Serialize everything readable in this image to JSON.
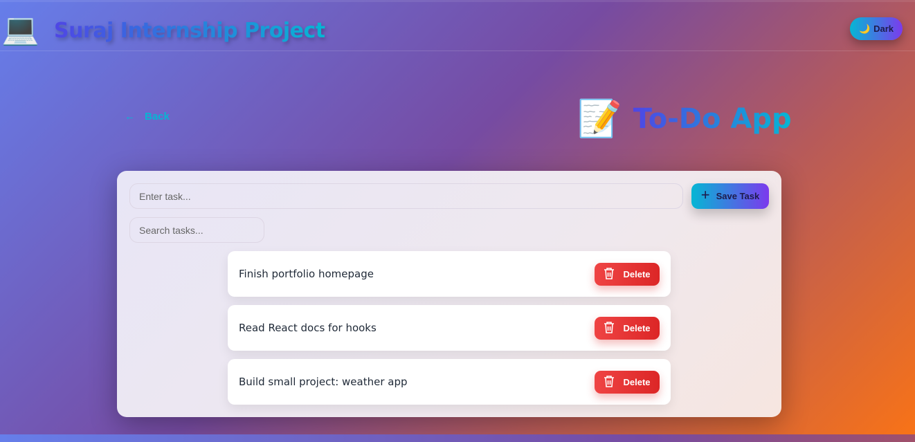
{
  "header": {
    "logo_icon": "💻",
    "title": "Suraj Internship Project",
    "theme_icon": "🌙",
    "theme_label": "Dark"
  },
  "page": {
    "back_label": "Back",
    "title_icon": "📝",
    "title": "To-Do App"
  },
  "form": {
    "task_placeholder": "Enter task...",
    "task_value": "",
    "search_placeholder": "Search tasks...",
    "search_value": "",
    "save_label": "Save Task"
  },
  "tasks": [
    {
      "text": "Finish portfolio homepage",
      "delete_label": "Delete"
    },
    {
      "text": "Read React docs for hooks",
      "delete_label": "Delete"
    },
    {
      "text": "Build small project: weather app",
      "delete_label": "Delete"
    }
  ]
}
